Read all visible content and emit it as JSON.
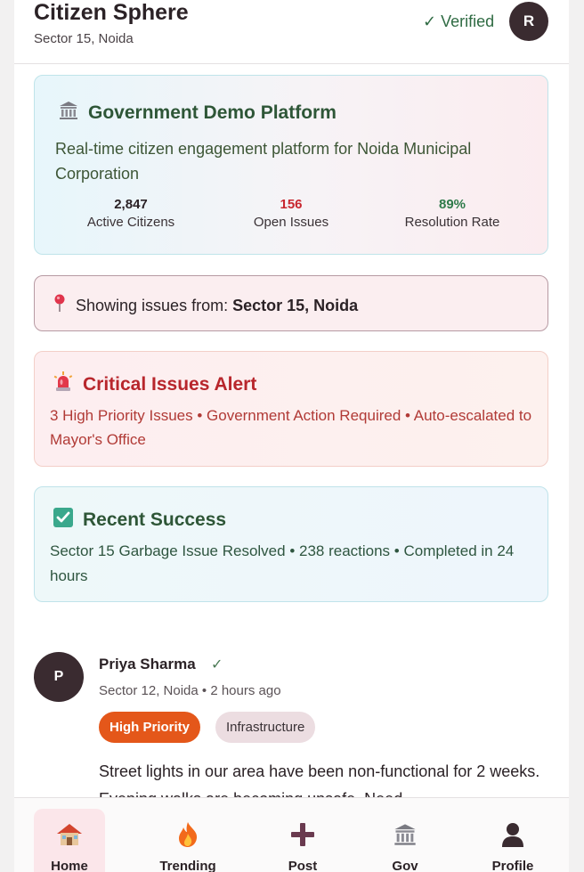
{
  "header": {
    "title": "Citizen Sphere",
    "location": "Sector 15, Noida",
    "verified_label": "✓ Verified",
    "avatar_initial": "R"
  },
  "gov_card": {
    "title": "Government Demo Platform",
    "icon": "government-building-icon",
    "description": "Real-time citizen engagement platform for Noida Municipal Corporation",
    "stats": [
      {
        "value": "2,847",
        "label": "Active Citizens",
        "color": "#2b2226"
      },
      {
        "value": "156",
        "label": "Open Issues",
        "color": "#c8262f"
      },
      {
        "value": "89%",
        "label": "Resolution Rate",
        "color": "#2f7a4a"
      }
    ]
  },
  "location_filter": {
    "icon": "pin-icon",
    "prefix": "Showing issues from:",
    "location": "Sector 15, Noida"
  },
  "alert_card": {
    "icon": "siren-icon",
    "title": "Critical Issues Alert",
    "description": "3 High Priority Issues • Government Action Required • Auto-escalated to Mayor's Office"
  },
  "success_card": {
    "icon": "checkbox-icon",
    "title": "Recent Success",
    "description": "Sector 15 Garbage Issue Resolved • 238 reactions • Completed in 24 hours"
  },
  "post": {
    "avatar_initial": "P",
    "author": "Priya Sharma",
    "verified_mark": "✓",
    "meta": "Sector 12, Noida • 2 hours ago",
    "tags": [
      {
        "label": "High Priority"
      },
      {
        "label": "Infrastructure"
      }
    ],
    "body": "Street lights in our area have been non-functional for 2 weeks. Evening walks are becoming unsafe. Need"
  },
  "bottom_nav": {
    "items": [
      {
        "label": "Home",
        "icon": "home-icon",
        "active": true
      },
      {
        "label": "Trending",
        "icon": "fire-icon",
        "active": false
      },
      {
        "label": "Post",
        "icon": "plus-icon",
        "active": false
      },
      {
        "label": "Gov",
        "icon": "government-building-icon",
        "active": false
      },
      {
        "label": "Profile",
        "icon": "user-icon",
        "active": false
      }
    ]
  },
  "colors": {
    "brand_dark": "#3a2b30",
    "priority_orange": "#e4571a",
    "alert_red": "#b8262c",
    "success_green": "#2e5637"
  }
}
